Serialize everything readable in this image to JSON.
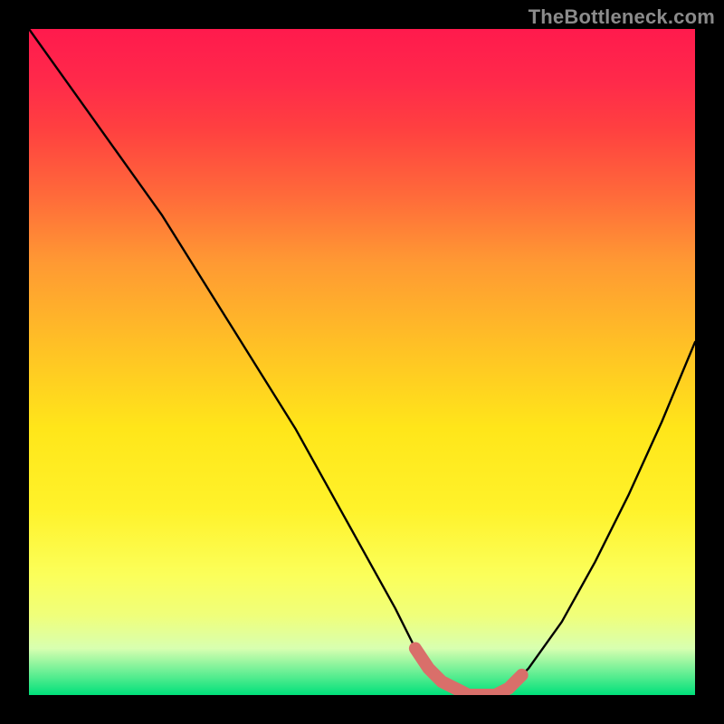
{
  "watermark": "TheBottleneck.com",
  "colors": {
    "background": "#000000",
    "curve": "#000000",
    "highlight": "#d96f6a",
    "gradient_top": "#ff1a4d",
    "gradient_bottom": "#00e07a"
  },
  "chart_data": {
    "type": "line",
    "title": "",
    "xlabel": "",
    "ylabel": "",
    "xlim": [
      0,
      100
    ],
    "ylim": [
      0,
      100
    ],
    "x": [
      0,
      5,
      10,
      15,
      20,
      25,
      30,
      35,
      40,
      45,
      50,
      55,
      58,
      60,
      62,
      64,
      66,
      68,
      70,
      72,
      75,
      80,
      85,
      90,
      95,
      100
    ],
    "values": [
      100,
      93,
      86,
      79,
      72,
      64,
      56,
      48,
      40,
      31,
      22,
      13,
      7,
      4,
      2,
      1,
      0,
      0,
      0,
      1,
      4,
      11,
      20,
      30,
      41,
      53
    ],
    "highlight_segment": {
      "x": [
        58,
        60,
        62,
        64,
        66,
        68,
        70,
        72,
        74
      ],
      "values": [
        7,
        4,
        2,
        1,
        0,
        0,
        0,
        1,
        3
      ]
    },
    "axes_visible": false,
    "grid": false,
    "legend": false
  }
}
